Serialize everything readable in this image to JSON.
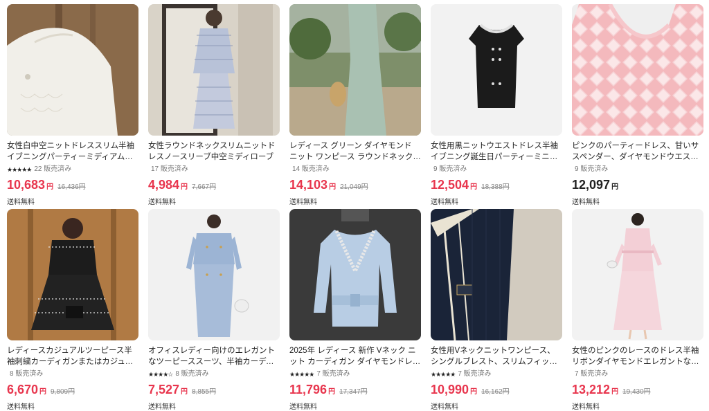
{
  "products": [
    {
      "title": "女性白中空ニットドレススリム半袖イブニングパーティーミディアムローブ",
      "rating_stars": "★★★★★",
      "sold": "22 販売済み",
      "price": "10,683",
      "currency": "円",
      "original_price": "16,436円",
      "shipping": "送料無料",
      "image_icon": "white-knit-dress-image"
    },
    {
      "title": "女性ラウンドネックスリムニットドレスノースリーブ中空ミディローブ",
      "rating_stars": "",
      "sold": "17 販売済み",
      "price": "4,984",
      "currency": "円",
      "original_price": "7,667円",
      "shipping": "送料無料",
      "image_icon": "tweed-set-image"
    },
    {
      "title": "レディース グリーン ダイヤモンド ニット ワンピース ラウンドネック シングルブレスト 半袖 スリム マ...",
      "rating_stars": "",
      "sold": "14 販売済み",
      "price": "14,103",
      "currency": "円",
      "original_price": "21,049円",
      "shipping": "送料無料",
      "image_icon": "green-knit-dress-image"
    },
    {
      "title": "女性用黒ニットウエストドレス半袖イブニング誕生日パーティーミニドレス",
      "rating_stars": "",
      "sold": "9 販売済み",
      "price": "12,504",
      "currency": "円",
      "original_price": "18,388円",
      "shipping": "送料無料",
      "image_icon": "black-mini-dress-image"
    },
    {
      "title": "ピンクのパーティードレス、甘いサスペンダー、ダイヤモンドウエスト、スリムなノースリーブニット、レ...",
      "rating_stars": "",
      "sold": "9 販売済み",
      "price": "12,097",
      "currency": "円",
      "original_price": "",
      "shipping": "送料無料",
      "image_icon": "pink-knit-dress-image"
    },
    {
      "title": "レディースカジュアルツーピース半袖刺繍カーディガンまたはカジュアルサスペンダードレス",
      "rating_stars": "",
      "sold": "8 販売済み",
      "price": "6,670",
      "currency": "円",
      "original_price": "9,809円",
      "shipping": "送料無料",
      "image_icon": "black-two-piece-image"
    },
    {
      "title": "オフィスレディー向けのエレガントなツーピーススーツ、半袖カーディガンまたはスリムフィットミディ...",
      "rating_stars": "★★★★☆",
      "sold": "8 販売済み",
      "price": "7,527",
      "currency": "円",
      "original_price": "8,855円",
      "shipping": "送料無料",
      "image_icon": "blue-suit-dress-image"
    },
    {
      "title": "2025年 レディース 新作 Vネック ニット カーディガン ダイヤモンドレース エレガント 冬トップス",
      "rating_stars": "★★★★★",
      "sold": "7 販売済み",
      "price": "11,796",
      "currency": "円",
      "original_price": "17,347円",
      "shipping": "送料無料",
      "image_icon": "blue-cardigan-image"
    },
    {
      "title": "女性用Vネックニットワンピース、シングルブレスト、スリムフィット、イブニングパーティー、レディー...",
      "rating_stars": "★★★★★",
      "sold": "7 販売済み",
      "price": "10,990",
      "currency": "円",
      "original_price": "16,162円",
      "shipping": "送料無料",
      "image_icon": "navy-knit-dress-image"
    },
    {
      "title": "女性のピンクのレースのドレス半袖リボンダイヤモンドエレガントなミディローブ",
      "rating_stars": "",
      "sold": "7 販売済み",
      "price": "13,212",
      "currency": "円",
      "original_price": "19,430円",
      "shipping": "送料無料",
      "image_icon": "pink-lace-dress-image"
    }
  ],
  "colors": {
    "sale_price": "#e8364e",
    "regular_price": "#222222",
    "muted": "#777777"
  }
}
